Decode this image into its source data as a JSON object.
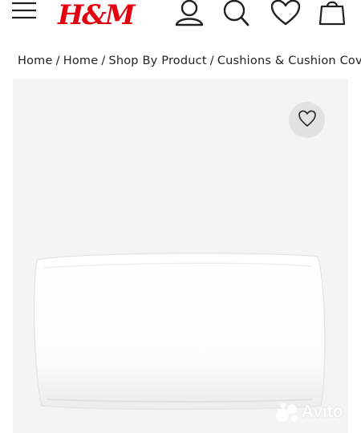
{
  "header": {
    "logo_text": "H&M",
    "icons": [
      "menu-icon",
      "account-icon",
      "search-icon",
      "heart-icon",
      "bag-icon"
    ]
  },
  "breadcrumb": {
    "items": [
      "Home",
      "Home",
      "Shop By Product",
      "Cushions & Cushion Covers"
    ],
    "separator": "/"
  },
  "product": {
    "image": "white-pillow",
    "favorite_icon": "heart-icon"
  },
  "watermark": {
    "text": "Avito"
  },
  "colors": {
    "brand": "#e50010",
    "background": "#ffffff",
    "image_background": "#f4f4f4",
    "text": "#222222"
  }
}
